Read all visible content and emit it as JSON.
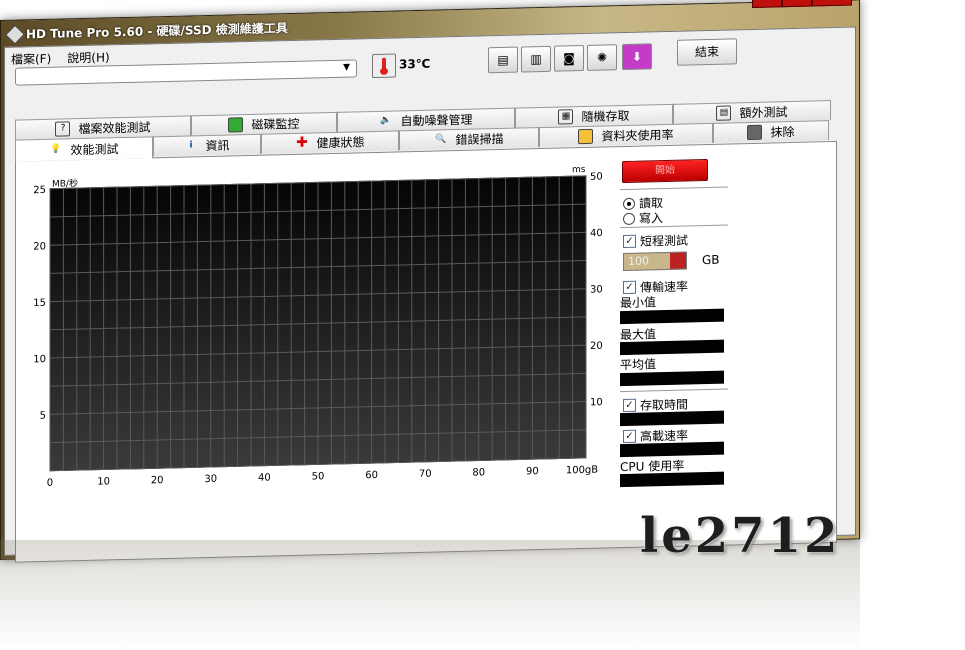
{
  "window": {
    "title": "HD Tune Pro 5.60 - 硬碟/SSD 檢測維護工具",
    "controls": [
      "▬",
      "❐",
      "✕"
    ]
  },
  "menu": [
    "檔案(F)",
    "說明(H)"
  ],
  "toolbar": {
    "drive_value": "",
    "temperature": "33℃",
    "exit_label": "結束",
    "tool_icons": [
      "copy-text-icon",
      "copy-info-icon",
      "screenshot-icon",
      "options-icon",
      "download-icon"
    ]
  },
  "tabs_top": [
    {
      "label": "檔案效能測試",
      "icon": "file-benchmark-icon"
    },
    {
      "label": "磁碟監控",
      "icon": "disk-monitor-icon"
    },
    {
      "label": "自動噪聲管理",
      "icon": "speaker-icon"
    },
    {
      "label": "隨機存取",
      "icon": "random-access-icon"
    },
    {
      "label": "額外測試",
      "icon": "extra-tests-icon"
    }
  ],
  "tabs_bottom": [
    {
      "label": "效能測試",
      "icon": "benchmark-icon",
      "active": true
    },
    {
      "label": "資訊",
      "icon": "info-icon"
    },
    {
      "label": "健康狀態",
      "icon": "health-icon"
    },
    {
      "label": "錯誤掃描",
      "icon": "error-scan-icon"
    },
    {
      "label": "資料夾使用率",
      "icon": "folder-usage-icon"
    },
    {
      "label": "抹除",
      "icon": "erase-icon"
    }
  ],
  "chart_data": {
    "type": "line",
    "xlabel": "gB",
    "ylabel_left": "MB/秒",
    "ylabel_right": "ms",
    "x_ticks": [
      "0",
      "10",
      "20",
      "30",
      "40",
      "50",
      "60",
      "70",
      "80",
      "90",
      "100gB"
    ],
    "y_left_ticks": [
      "25",
      "20",
      "15",
      "10",
      "5"
    ],
    "y_right_ticks": [
      "50",
      "40",
      "30",
      "20",
      "10"
    ],
    "xlim": [
      0,
      100
    ],
    "ylim_left": [
      0,
      25
    ],
    "ylim_right": [
      0,
      50
    ],
    "grid": true,
    "series": []
  },
  "controls": {
    "start_label": "開始",
    "mode_read": "讀取",
    "mode_write": "寫入",
    "short_test": "短程測試",
    "gb_value": "100",
    "gb_unit": "GB",
    "transfer_rate": "傳輸速率",
    "min_label": "最小值",
    "max_label": "最大值",
    "avg_label": "平均值",
    "access_time": "存取時間",
    "burst_rate": "高載速率",
    "cpu_usage": "CPU 使用率"
  },
  "watermark": "le2712"
}
